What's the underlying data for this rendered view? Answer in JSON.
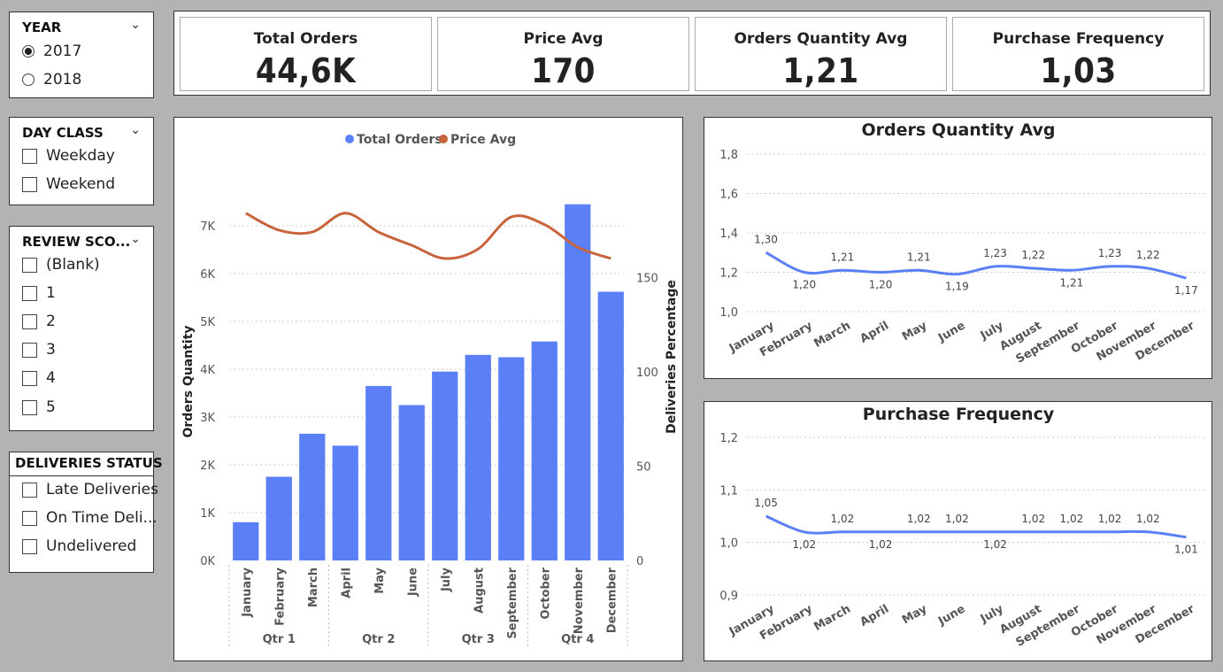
{
  "slicers": {
    "year": {
      "title": "YEAR",
      "options": [
        "2017",
        "2018"
      ],
      "selected": "2017"
    },
    "day_class": {
      "title": "DAY CLASS",
      "options": [
        "Weekday",
        "Weekend"
      ]
    },
    "review_score": {
      "title": "REVIEW SCO...",
      "options": [
        "(Blank)",
        "1",
        "2",
        "3",
        "4",
        "5"
      ]
    },
    "deliveries_status": {
      "title": "DELIVERIES STATUS",
      "options": [
        "Late Deliveries",
        "On Time Deli...",
        "Undelivered"
      ]
    }
  },
  "kpis": [
    {
      "label": "Total Orders",
      "value": "44,6K"
    },
    {
      "label": "Price Avg",
      "value": "170"
    },
    {
      "label": "Orders Quantity Avg",
      "value": "1,21"
    },
    {
      "label": "Purchase Frequency",
      "value": "1,03"
    }
  ],
  "colors": {
    "bar": "#5b7ff5",
    "line": "#c8643c",
    "line_blue": "#5b7ff5",
    "grid": "#cccccc"
  },
  "chart_data": [
    {
      "type": "bar",
      "title": "",
      "legend": {
        "position": "top",
        "entries": [
          "Total Orders",
          "Price Avg"
        ]
      },
      "categories": [
        "January",
        "February",
        "March",
        "April",
        "May",
        "June",
        "July",
        "August",
        "September",
        "October",
        "November",
        "December"
      ],
      "groups": [
        {
          "label": "Qtr 1",
          "span": 3
        },
        {
          "label": "Qtr 2",
          "span": 3
        },
        {
          "label": "Qtr 3",
          "span": 3
        },
        {
          "label": "Qtr 4",
          "span": 3
        }
      ],
      "series": [
        {
          "name": "Total Orders",
          "type": "bar",
          "axis": "left",
          "values": [
            800,
            1750,
            2650,
            2400,
            3650,
            3250,
            3950,
            4300,
            4250,
            4580,
            7450,
            5620
          ]
        },
        {
          "name": "Price Avg",
          "type": "line",
          "axis": "right",
          "values": [
            184,
            175,
            174,
            184,
            174,
            167,
            160,
            165,
            182,
            178,
            166,
            160
          ]
        }
      ],
      "ylabel": "Orders Quantity",
      "ylabel_right": "Deliveries Percentage",
      "ylim": [
        0,
        7500
      ],
      "yticks": [
        "0K",
        "1K",
        "2K",
        "3K",
        "4K",
        "5K",
        "6K",
        "7K"
      ],
      "ylim_right": [
        0,
        190
      ],
      "yticks_right": [
        "0",
        "50",
        "100",
        "150"
      ],
      "grid": true
    },
    {
      "type": "line",
      "title": "Orders Quantity Avg",
      "x": [
        "January",
        "February",
        "March",
        "April",
        "May",
        "June",
        "July",
        "August",
        "September",
        "October",
        "November",
        "December"
      ],
      "values": [
        1.3,
        1.2,
        1.21,
        1.2,
        1.21,
        1.19,
        1.23,
        1.22,
        1.21,
        1.23,
        1.22,
        1.17
      ],
      "data_labels": [
        "1,30",
        "1,20",
        "1,21",
        "1,20",
        "1,21",
        "1,19",
        "1,23",
        "1,22",
        "1,21",
        "1,23",
        "1,22",
        "1,17"
      ],
      "yticks": [
        "1,0",
        "1,2",
        "1,4",
        "1,6",
        "1,8"
      ],
      "ylim": [
        1.0,
        1.8
      ],
      "grid": true
    },
    {
      "type": "line",
      "title": "Purchase Frequency",
      "x": [
        "January",
        "February",
        "March",
        "April",
        "May",
        "June",
        "July",
        "August",
        "September",
        "October",
        "November",
        "December"
      ],
      "values": [
        1.05,
        1.02,
        1.02,
        1.02,
        1.02,
        1.02,
        1.02,
        1.02,
        1.02,
        1.02,
        1.02,
        1.01
      ],
      "data_labels": [
        "1,05",
        "1,02",
        "1,02",
        "1,02",
        "1,02",
        "1,02",
        "1,02",
        "1,02",
        "1,02",
        "1,02",
        "1,02",
        "1,01"
      ],
      "yticks": [
        "0,9",
        "1,0",
        "1,1",
        "1,2"
      ],
      "ylim": [
        0.9,
        1.2
      ],
      "grid": true
    }
  ]
}
